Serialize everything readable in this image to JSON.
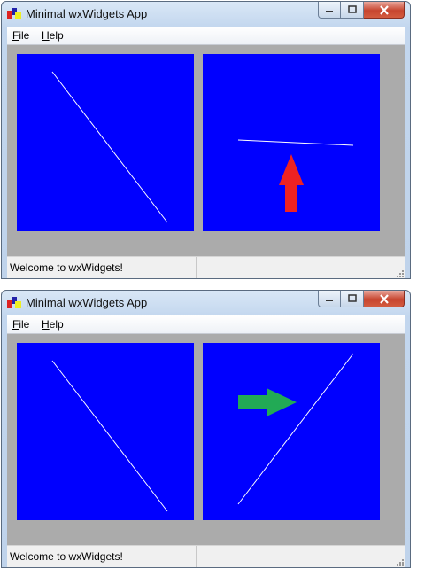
{
  "windows": [
    {
      "title": "Minimal wxWidgets App",
      "menu": {
        "file_rest": "ile",
        "help_rest": "elp",
        "file_key": "F",
        "help_key": "H"
      },
      "status": {
        "text": "Welcome to wxWidgets!",
        "field2": ""
      },
      "arrow": {
        "color": "#ee2222",
        "icon": "arrow-up-icon",
        "direction": "up"
      }
    },
    {
      "title": "Minimal wxWidgets App",
      "menu": {
        "file_rest": "ile",
        "help_rest": "elp",
        "file_key": "F",
        "help_key": "H"
      },
      "status": {
        "text": "Welcome to wxWidgets!",
        "field2": ""
      },
      "arrow": {
        "color": "#22aa55",
        "icon": "arrow-right-icon",
        "direction": "right"
      }
    }
  ],
  "colors": {
    "panel_bg": "#0000ff",
    "client_bg": "#ababab",
    "line": "#ffffff"
  }
}
